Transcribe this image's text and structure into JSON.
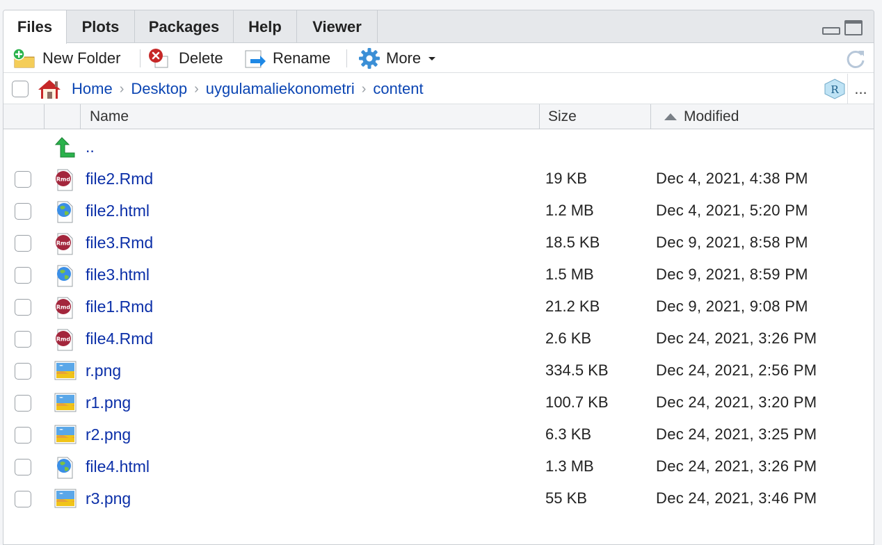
{
  "tabs": [
    {
      "label": "Files",
      "active": true
    },
    {
      "label": "Plots"
    },
    {
      "label": "Packages"
    },
    {
      "label": "Help"
    },
    {
      "label": "Viewer"
    }
  ],
  "toolbar": {
    "new_folder": "New Folder",
    "delete": "Delete",
    "rename": "Rename",
    "more": "More"
  },
  "breadcrumb": {
    "home": "Home",
    "items": [
      "Desktop",
      "uygulamaliekonometri",
      "content"
    ],
    "more": "..."
  },
  "columns": {
    "name": "Name",
    "size": "Size",
    "modified": "Modified"
  },
  "parent_dir": "..",
  "files": [
    {
      "name": "file2.Rmd",
      "size": "19 KB",
      "modified": "Dec 4, 2021, 4:38 PM",
      "type": "rmd"
    },
    {
      "name": "file2.html",
      "size": "1.2 MB",
      "modified": "Dec 4, 2021, 5:20 PM",
      "type": "html"
    },
    {
      "name": "file3.Rmd",
      "size": "18.5 KB",
      "modified": "Dec 9, 2021, 8:58 PM",
      "type": "rmd"
    },
    {
      "name": "file3.html",
      "size": "1.5 MB",
      "modified": "Dec 9, 2021, 8:59 PM",
      "type": "html"
    },
    {
      "name": "file1.Rmd",
      "size": "21.2 KB",
      "modified": "Dec 9, 2021, 9:08 PM",
      "type": "rmd"
    },
    {
      "name": "file4.Rmd",
      "size": "2.6 KB",
      "modified": "Dec 24, 2021, 3:26 PM",
      "type": "rmd"
    },
    {
      "name": "r.png",
      "size": "334.5 KB",
      "modified": "Dec 24, 2021, 2:56 PM",
      "type": "png"
    },
    {
      "name": "r1.png",
      "size": "100.7 KB",
      "modified": "Dec 24, 2021, 3:20 PM",
      "type": "png"
    },
    {
      "name": "r2.png",
      "size": "6.3 KB",
      "modified": "Dec 24, 2021, 3:25 PM",
      "type": "png"
    },
    {
      "name": "file4.html",
      "size": "1.3 MB",
      "modified": "Dec 24, 2021, 3:26 PM",
      "type": "html"
    },
    {
      "name": "r3.png",
      "size": "55 KB",
      "modified": "Dec 24, 2021, 3:46 PM",
      "type": "png"
    }
  ],
  "icons": {
    "rmd": "rmd-file-icon",
    "html": "html-file-icon",
    "png": "image-file-icon"
  },
  "colors": {
    "link": "#0b2fa8",
    "rmd_badge": "#a3263c",
    "new_folder_plus": "#2bb24c",
    "delete_x": "#c62828",
    "up_arrow": "#2bb24c"
  }
}
